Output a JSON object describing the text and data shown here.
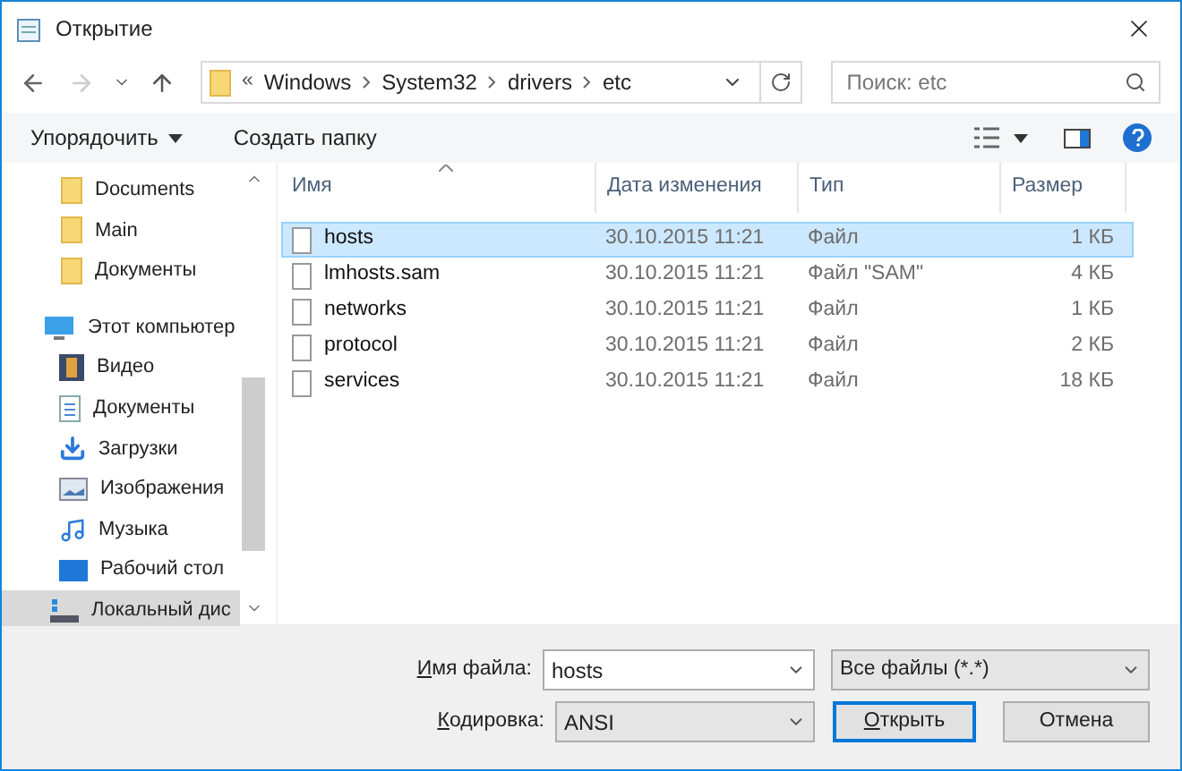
{
  "window": {
    "title": "Открытие"
  },
  "address": {
    "path": [
      {
        "label": "Windows"
      },
      {
        "label": "System32"
      },
      {
        "label": "drivers"
      },
      {
        "label": "etc"
      }
    ],
    "overflow": "«"
  },
  "search": {
    "placeholder": "Поиск: etc"
  },
  "toolbar": {
    "organize": "Упорядочить",
    "new_folder": "Создать папку"
  },
  "sidebar": {
    "items": [
      {
        "label": "Documents",
        "kind": "folder",
        "selected": false
      },
      {
        "label": "Main",
        "kind": "folder",
        "selected": false
      },
      {
        "label": "Документы",
        "kind": "folder",
        "selected": false
      },
      {
        "label": "Этот компьютер",
        "kind": "computer",
        "selected": false
      },
      {
        "label": "Видео",
        "kind": "video",
        "selected": false
      },
      {
        "label": "Документы",
        "kind": "docs",
        "selected": false
      },
      {
        "label": "Загрузки",
        "kind": "downloads",
        "selected": false
      },
      {
        "label": "Изображения",
        "kind": "pictures",
        "selected": false
      },
      {
        "label": "Музыка",
        "kind": "music",
        "selected": false
      },
      {
        "label": "Рабочий стол",
        "kind": "desktop",
        "selected": false
      },
      {
        "label": "Локальный дис",
        "kind": "drive",
        "selected": true
      }
    ]
  },
  "table": {
    "columns": [
      "Имя",
      "Дата изменения",
      "Тип",
      "Размер"
    ],
    "rows": [
      {
        "name": "hosts",
        "date": "30.10.2015 11:21",
        "type": "Файл",
        "size": "1 КБ",
        "selected": true
      },
      {
        "name": "lmhosts.sam",
        "date": "30.10.2015 11:21",
        "type": "Файл \"SAM\"",
        "size": "4 КБ",
        "selected": false
      },
      {
        "name": "networks",
        "date": "30.10.2015 11:21",
        "type": "Файл",
        "size": "1 КБ",
        "selected": false
      },
      {
        "name": "protocol",
        "date": "30.10.2015 11:21",
        "type": "Файл",
        "size": "2 КБ",
        "selected": false
      },
      {
        "name": "services",
        "date": "30.10.2015 11:21",
        "type": "Файл",
        "size": "18 КБ",
        "selected": false
      }
    ]
  },
  "footer": {
    "filename_label": "Имя файла:",
    "filename": "hosts",
    "filter": "Все файлы (*.*)",
    "encoding_label": "Кодировка:",
    "encoding": "ANSI",
    "open": "Открыть",
    "cancel": "Отмена"
  }
}
